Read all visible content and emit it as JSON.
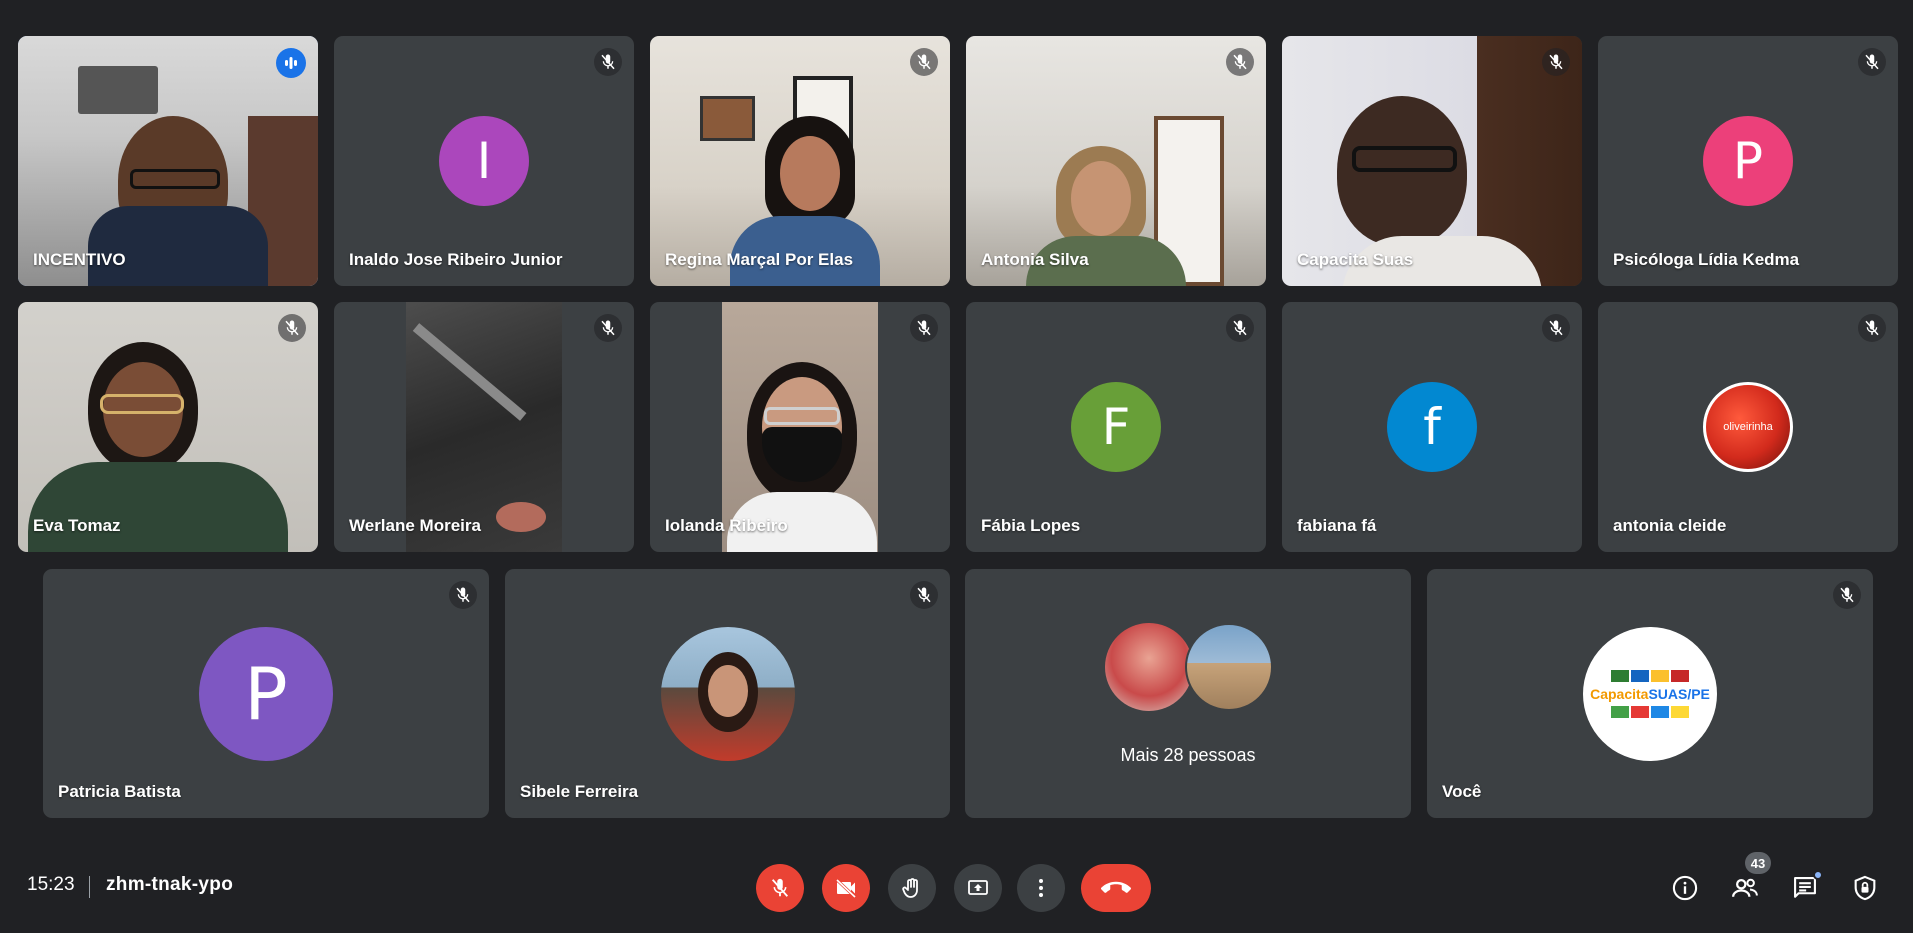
{
  "meeting": {
    "time": "15:23",
    "code": "zhm-tnak-ypo"
  },
  "participants": {
    "incentivo": {
      "name": "INCENTIVO"
    },
    "inaldo": {
      "name": "Inaldo Jose Ribeiro Junior",
      "initial": "I",
      "color": "#ab47bc"
    },
    "regina": {
      "name": "Regina Marçal Por Elas"
    },
    "antonia_silva": {
      "name": "Antonia Silva"
    },
    "capacita": {
      "name": "Capacita Suas"
    },
    "psicologa": {
      "name": "Psicóloga Lídia Kedma",
      "initial": "P",
      "color": "#ec407a"
    },
    "eva": {
      "name": "Eva Tomaz"
    },
    "werlane": {
      "name": "Werlane Moreira"
    },
    "iolanda": {
      "name": "Iolanda Ribeiro"
    },
    "fabia": {
      "name": "Fábia Lopes",
      "initial": "F",
      "color": "#689f38"
    },
    "fabiana": {
      "name": "fabiana fá",
      "initial": "f",
      "color": "#0288d1"
    },
    "antonia_cleide": {
      "name": "antonia cleide",
      "avatar_text": "oliveirinha"
    },
    "patricia": {
      "name": "Patricia Batista",
      "initial": "P",
      "color": "#7e57c2"
    },
    "sibele": {
      "name": "Sibele Ferreira"
    },
    "more": {
      "label": "Mais 28 pessoas"
    },
    "voce": {
      "name": "Você",
      "logo_text_1": "Capacita",
      "logo_text_2": "SUAS/PE"
    }
  },
  "toolbar": {
    "people_count": "43",
    "icons": {
      "mic": "mic-off-icon",
      "cam": "camera-off-icon",
      "hand": "raise-hand-icon",
      "present": "present-screen-icon",
      "more": "more-options-icon",
      "hangup": "hang-up-icon",
      "info": "info-icon",
      "people": "people-icon",
      "chat": "chat-icon",
      "safety": "host-controls-icon"
    }
  },
  "colors": {
    "accent": "#8ab4f8",
    "danger": "#ea4335",
    "tile": "#3c4043",
    "background": "#202124"
  }
}
